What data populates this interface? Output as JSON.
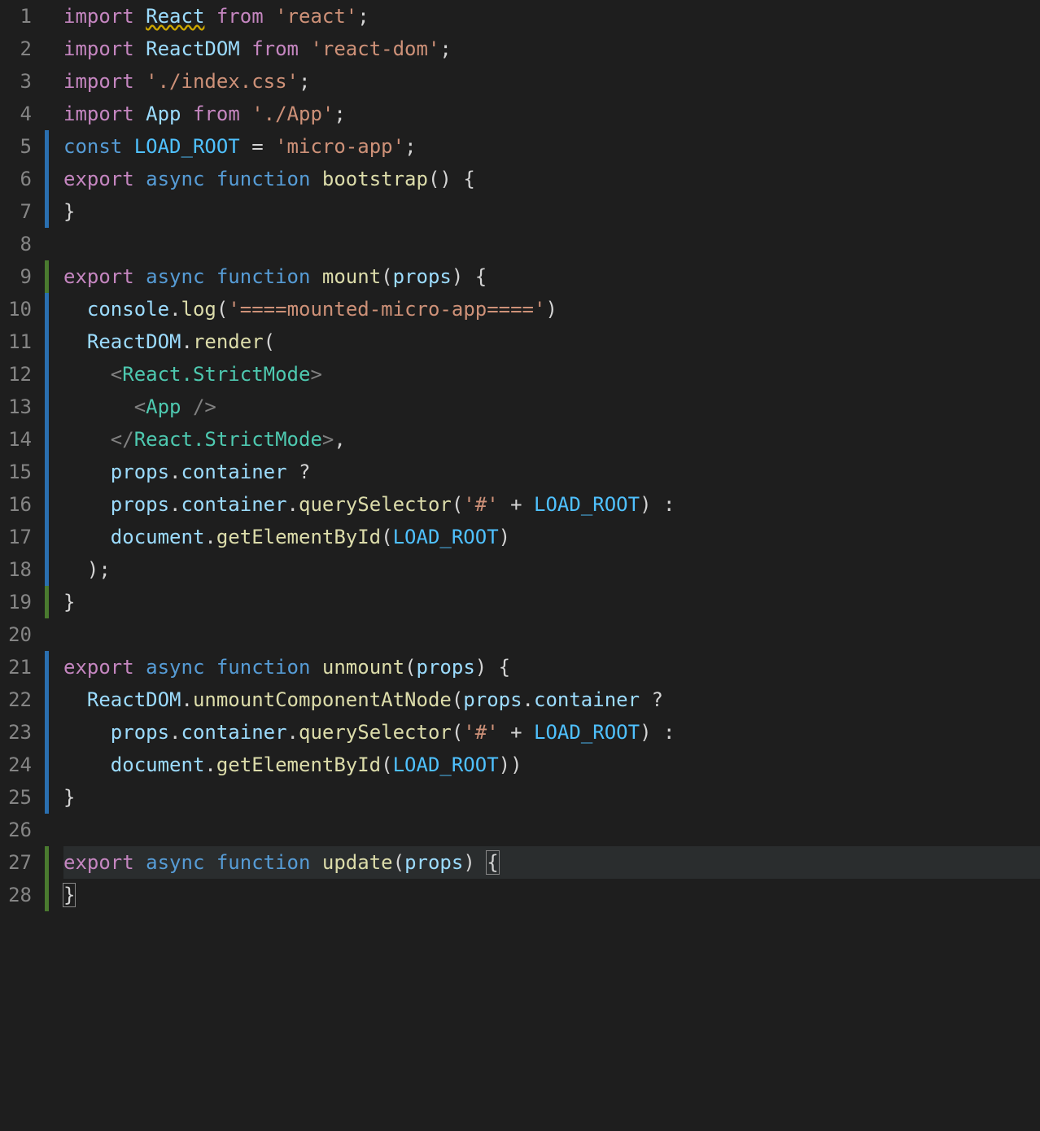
{
  "editor": {
    "language": "javascript-react",
    "currentLine": 27,
    "lines": [
      {
        "num": 1,
        "git": "",
        "tokens": [
          [
            "keyword",
            "import"
          ],
          [
            "",
            " "
          ],
          [
            "ident warn",
            "React"
          ],
          [
            "",
            " "
          ],
          [
            "keyword",
            "from"
          ],
          [
            "",
            " "
          ],
          [
            "string",
            "'react'"
          ],
          [
            "punct",
            ";"
          ]
        ]
      },
      {
        "num": 2,
        "git": "",
        "tokens": [
          [
            "keyword",
            "import"
          ],
          [
            "",
            " "
          ],
          [
            "ident",
            "ReactDOM"
          ],
          [
            "",
            " "
          ],
          [
            "keyword",
            "from"
          ],
          [
            "",
            " "
          ],
          [
            "string",
            "'react-dom'"
          ],
          [
            "punct",
            ";"
          ]
        ]
      },
      {
        "num": 3,
        "git": "",
        "tokens": [
          [
            "keyword",
            "import"
          ],
          [
            "",
            " "
          ],
          [
            "string",
            "'./index.css'"
          ],
          [
            "punct",
            ";"
          ]
        ]
      },
      {
        "num": 4,
        "git": "",
        "tokens": [
          [
            "keyword",
            "import"
          ],
          [
            "",
            " "
          ],
          [
            "ident",
            "App"
          ],
          [
            "",
            " "
          ],
          [
            "keyword",
            "from"
          ],
          [
            "",
            " "
          ],
          [
            "string",
            "'./App'"
          ],
          [
            "punct",
            ";"
          ]
        ]
      },
      {
        "num": 5,
        "git": "blue",
        "tokens": [
          [
            "blue",
            "const"
          ],
          [
            "",
            " "
          ],
          [
            "const",
            "LOAD_ROOT"
          ],
          [
            "",
            " "
          ],
          [
            "punct",
            "="
          ],
          [
            "",
            " "
          ],
          [
            "string",
            "'micro-app'"
          ],
          [
            "punct",
            ";"
          ]
        ]
      },
      {
        "num": 6,
        "git": "blue",
        "tokens": [
          [
            "keyword",
            "export"
          ],
          [
            "",
            " "
          ],
          [
            "blue",
            "async"
          ],
          [
            "",
            " "
          ],
          [
            "blue",
            "function"
          ],
          [
            "",
            " "
          ],
          [
            "func",
            "bootstrap"
          ],
          [
            "punct",
            "()"
          ],
          [
            "",
            " "
          ],
          [
            "punct",
            "{"
          ]
        ]
      },
      {
        "num": 7,
        "git": "blue",
        "tokens": [
          [
            "punct",
            "}"
          ]
        ]
      },
      {
        "num": 8,
        "git": "",
        "tokens": []
      },
      {
        "num": 9,
        "git": "green",
        "tokens": [
          [
            "keyword",
            "export"
          ],
          [
            "",
            " "
          ],
          [
            "blue",
            "async"
          ],
          [
            "",
            " "
          ],
          [
            "blue",
            "function"
          ],
          [
            "",
            " "
          ],
          [
            "func",
            "mount"
          ],
          [
            "punct",
            "("
          ],
          [
            "prop",
            "props"
          ],
          [
            "punct",
            ")"
          ],
          [
            "",
            " "
          ],
          [
            "punct",
            "{"
          ]
        ]
      },
      {
        "num": 10,
        "git": "blue",
        "tokens": [
          [
            "",
            "  "
          ],
          [
            "prop",
            "console"
          ],
          [
            "punct",
            "."
          ],
          [
            "func",
            "log"
          ],
          [
            "punct",
            "("
          ],
          [
            "string",
            "'====mounted-micro-app===='"
          ],
          [
            "punct",
            ")"
          ]
        ]
      },
      {
        "num": 11,
        "git": "blue",
        "tokens": [
          [
            "",
            "  "
          ],
          [
            "ident",
            "ReactDOM"
          ],
          [
            "punct",
            "."
          ],
          [
            "func",
            "render"
          ],
          [
            "punct",
            "("
          ]
        ]
      },
      {
        "num": 12,
        "git": "blue",
        "tokens": [
          [
            "",
            "    "
          ],
          [
            "tag",
            "<"
          ],
          [
            "comp",
            "React.StrictMode"
          ],
          [
            "tag",
            ">"
          ]
        ]
      },
      {
        "num": 13,
        "git": "blue",
        "tokens": [
          [
            "",
            "      "
          ],
          [
            "tag",
            "<"
          ],
          [
            "comp",
            "App"
          ],
          [
            "",
            " "
          ],
          [
            "tag",
            "/>"
          ]
        ]
      },
      {
        "num": 14,
        "git": "blue",
        "tokens": [
          [
            "",
            "    "
          ],
          [
            "tag",
            "</"
          ],
          [
            "comp",
            "React.StrictMode"
          ],
          [
            "tag",
            ">"
          ],
          [
            "punct",
            ","
          ]
        ]
      },
      {
        "num": 15,
        "git": "blue",
        "tokens": [
          [
            "",
            "    "
          ],
          [
            "prop",
            "props"
          ],
          [
            "punct",
            "."
          ],
          [
            "prop",
            "container"
          ],
          [
            "",
            " "
          ],
          [
            "punct",
            "?"
          ]
        ]
      },
      {
        "num": 16,
        "git": "blue",
        "tokens": [
          [
            "",
            "    "
          ],
          [
            "prop",
            "props"
          ],
          [
            "punct",
            "."
          ],
          [
            "prop",
            "container"
          ],
          [
            "punct",
            "."
          ],
          [
            "func",
            "querySelector"
          ],
          [
            "punct",
            "("
          ],
          [
            "string",
            "'#'"
          ],
          [
            "",
            " "
          ],
          [
            "punct",
            "+"
          ],
          [
            "",
            " "
          ],
          [
            "const",
            "LOAD_ROOT"
          ],
          [
            "punct",
            ")"
          ],
          [
            "",
            " "
          ],
          [
            "punct",
            ":"
          ]
        ]
      },
      {
        "num": 17,
        "git": "blue",
        "tokens": [
          [
            "",
            "    "
          ],
          [
            "prop",
            "document"
          ],
          [
            "punct",
            "."
          ],
          [
            "func",
            "getElementById"
          ],
          [
            "punct",
            "("
          ],
          [
            "const",
            "LOAD_ROOT"
          ],
          [
            "punct",
            ")"
          ]
        ]
      },
      {
        "num": 18,
        "git": "blue",
        "tokens": [
          [
            "",
            "  "
          ],
          [
            "punct",
            ");"
          ]
        ]
      },
      {
        "num": 19,
        "git": "green",
        "tokens": [
          [
            "punct",
            "}"
          ]
        ]
      },
      {
        "num": 20,
        "git": "",
        "tokens": []
      },
      {
        "num": 21,
        "git": "blue",
        "tokens": [
          [
            "keyword",
            "export"
          ],
          [
            "",
            " "
          ],
          [
            "blue",
            "async"
          ],
          [
            "",
            " "
          ],
          [
            "blue",
            "function"
          ],
          [
            "",
            " "
          ],
          [
            "func",
            "unmount"
          ],
          [
            "punct",
            "("
          ],
          [
            "prop",
            "props"
          ],
          [
            "punct",
            ")"
          ],
          [
            "",
            " "
          ],
          [
            "punct",
            "{"
          ]
        ]
      },
      {
        "num": 22,
        "git": "blue",
        "tokens": [
          [
            "",
            "  "
          ],
          [
            "ident",
            "ReactDOM"
          ],
          [
            "punct",
            "."
          ],
          [
            "func",
            "unmountComponentAtNode"
          ],
          [
            "punct",
            "("
          ],
          [
            "prop",
            "props"
          ],
          [
            "punct",
            "."
          ],
          [
            "prop",
            "container"
          ],
          [
            "",
            " "
          ],
          [
            "punct",
            "?"
          ]
        ]
      },
      {
        "num": 23,
        "git": "blue",
        "tokens": [
          [
            "",
            "    "
          ],
          [
            "prop",
            "props"
          ],
          [
            "punct",
            "."
          ],
          [
            "prop",
            "container"
          ],
          [
            "punct",
            "."
          ],
          [
            "func",
            "querySelector"
          ],
          [
            "punct",
            "("
          ],
          [
            "string",
            "'#'"
          ],
          [
            "",
            " "
          ],
          [
            "punct",
            "+"
          ],
          [
            "",
            " "
          ],
          [
            "const",
            "LOAD_ROOT"
          ],
          [
            "punct",
            ")"
          ],
          [
            "",
            " "
          ],
          [
            "punct",
            ":"
          ]
        ]
      },
      {
        "num": 24,
        "git": "blue",
        "tokens": [
          [
            "",
            "    "
          ],
          [
            "prop",
            "document"
          ],
          [
            "punct",
            "."
          ],
          [
            "func",
            "getElementById"
          ],
          [
            "punct",
            "("
          ],
          [
            "const",
            "LOAD_ROOT"
          ],
          [
            "punct",
            "))"
          ]
        ]
      },
      {
        "num": 25,
        "git": "blue",
        "tokens": [
          [
            "punct",
            "}"
          ]
        ]
      },
      {
        "num": 26,
        "git": "",
        "tokens": []
      },
      {
        "num": 27,
        "git": "green",
        "tokens": [
          [
            "keyword",
            "export"
          ],
          [
            "",
            " "
          ],
          [
            "blue",
            "async"
          ],
          [
            "",
            " "
          ],
          [
            "blue",
            "function"
          ],
          [
            "",
            " "
          ],
          [
            "func",
            "update"
          ],
          [
            "punct",
            "("
          ],
          [
            "prop",
            "props"
          ],
          [
            "punct",
            ")"
          ],
          [
            "",
            " "
          ],
          [
            "punct bm",
            "{"
          ]
        ]
      },
      {
        "num": 28,
        "git": "green",
        "tokens": [
          [
            "punct bm",
            "}"
          ]
        ]
      }
    ]
  }
}
